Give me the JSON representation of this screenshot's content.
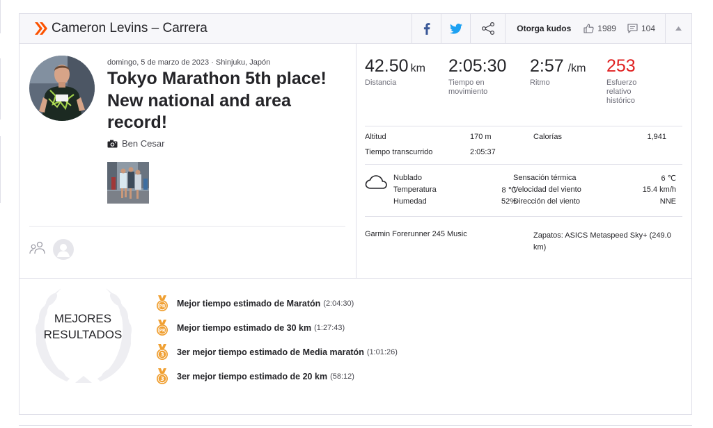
{
  "header": {
    "title": "Cameron Levins – Carrera",
    "give_kudos": "Otorga kudos",
    "kudos_count": "1989",
    "comments_count": "104"
  },
  "activity": {
    "date_location": "domingo, 5 de marzo de 2023 · Shinjuku, Japón",
    "title": "Tokyo Marathon 5th place! New national and area record!",
    "photo_credit": "Ben Cesar"
  },
  "stats": {
    "distance": {
      "value": "42.50",
      "unit": "km",
      "label": "Distancia"
    },
    "moving_time": {
      "value": "2:05:30",
      "label": "Tiempo en movimiento"
    },
    "pace": {
      "value": "2:57",
      "unit": "/km",
      "label": "Ritmo"
    },
    "relative_effort": {
      "value": "253",
      "label": "Esfuerzo relativo histórico"
    }
  },
  "details": {
    "elevation_label": "Altitud",
    "elevation_value": "170 m",
    "calories_label": "Calorías",
    "calories_value": "1,941",
    "elapsed_label": "Tiempo transcurrido",
    "elapsed_value": "2:05:37"
  },
  "weather": {
    "condition": "Nublado",
    "temperature_label": "Temperatura",
    "temperature_value": "8 ℃",
    "humidity_label": "Humedad",
    "humidity_value": "52%",
    "feels_like_label": "Sensación térmica",
    "feels_like_value": "6 ℃",
    "wind_speed_label": "Velocidad del viento",
    "wind_speed_value": "15.4 km/h",
    "wind_dir_label": "Dirección del viento",
    "wind_dir_value": "NNE"
  },
  "gear": {
    "device": "Garmin Forerunner 245 Music",
    "shoes_line1": "Zapatos: ASICS Metaspeed Sky+ (249.0",
    "shoes_line2": "km)"
  },
  "achievements": {
    "heading_line1": "MEJORES",
    "heading_line2": "RESULTADOS",
    "items": [
      {
        "text": "Mejor tiempo estimado de Maratón",
        "time": "(2:04:30)",
        "medal": "pr"
      },
      {
        "text": "Mejor tiempo estimado de 30 km",
        "time": "(1:27:43)",
        "medal": "pr"
      },
      {
        "text": "3er mejor tiempo estimado de Media maratón",
        "time": "(1:01:26)",
        "medal": "3"
      },
      {
        "text": "3er mejor tiempo estimado de 20 km",
        "time": "(58:12)",
        "medal": "3"
      }
    ]
  },
  "colors": {
    "brand": "#fc5200",
    "facebook": "#3b5998",
    "twitter": "#1da1f2",
    "relative_effort": "#e02020",
    "medal": "#f0a033"
  }
}
